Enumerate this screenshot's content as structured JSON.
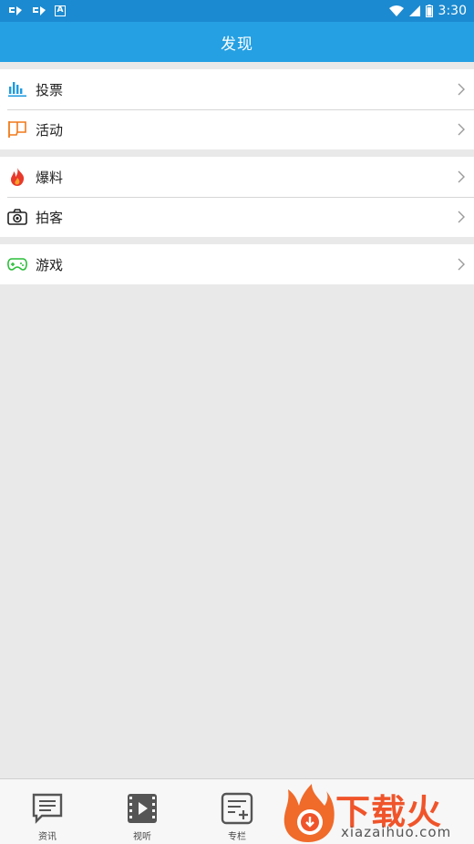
{
  "status": {
    "time": "3:30",
    "notif_letter": "A"
  },
  "header": {
    "title": "发现"
  },
  "groups": [
    {
      "items": [
        {
          "label": "投票",
          "icon": "bar-chart-icon",
          "color": "#1e9be0"
        },
        {
          "label": "活动",
          "icon": "flag-icon",
          "color": "#f07a1a"
        }
      ]
    },
    {
      "items": [
        {
          "label": "爆料",
          "icon": "fire-icon",
          "color": "#e8392b"
        },
        {
          "label": "拍客",
          "icon": "camera-icon",
          "color": "#222222"
        }
      ]
    },
    {
      "items": [
        {
          "label": "游戏",
          "icon": "gamepad-icon",
          "color": "#2bbf3a"
        }
      ]
    }
  ],
  "tabs": [
    {
      "label": "资讯",
      "icon": "news-icon"
    },
    {
      "label": "视听",
      "icon": "video-icon"
    },
    {
      "label": "专栏",
      "icon": "column-icon"
    }
  ],
  "watermark": {
    "brand": "下载火",
    "domain": "xiazaihuo.com"
  },
  "colors": {
    "app_bar": "#25a0e3",
    "status_bar": "#1c8ad0",
    "background": "#e9e9e9"
  }
}
